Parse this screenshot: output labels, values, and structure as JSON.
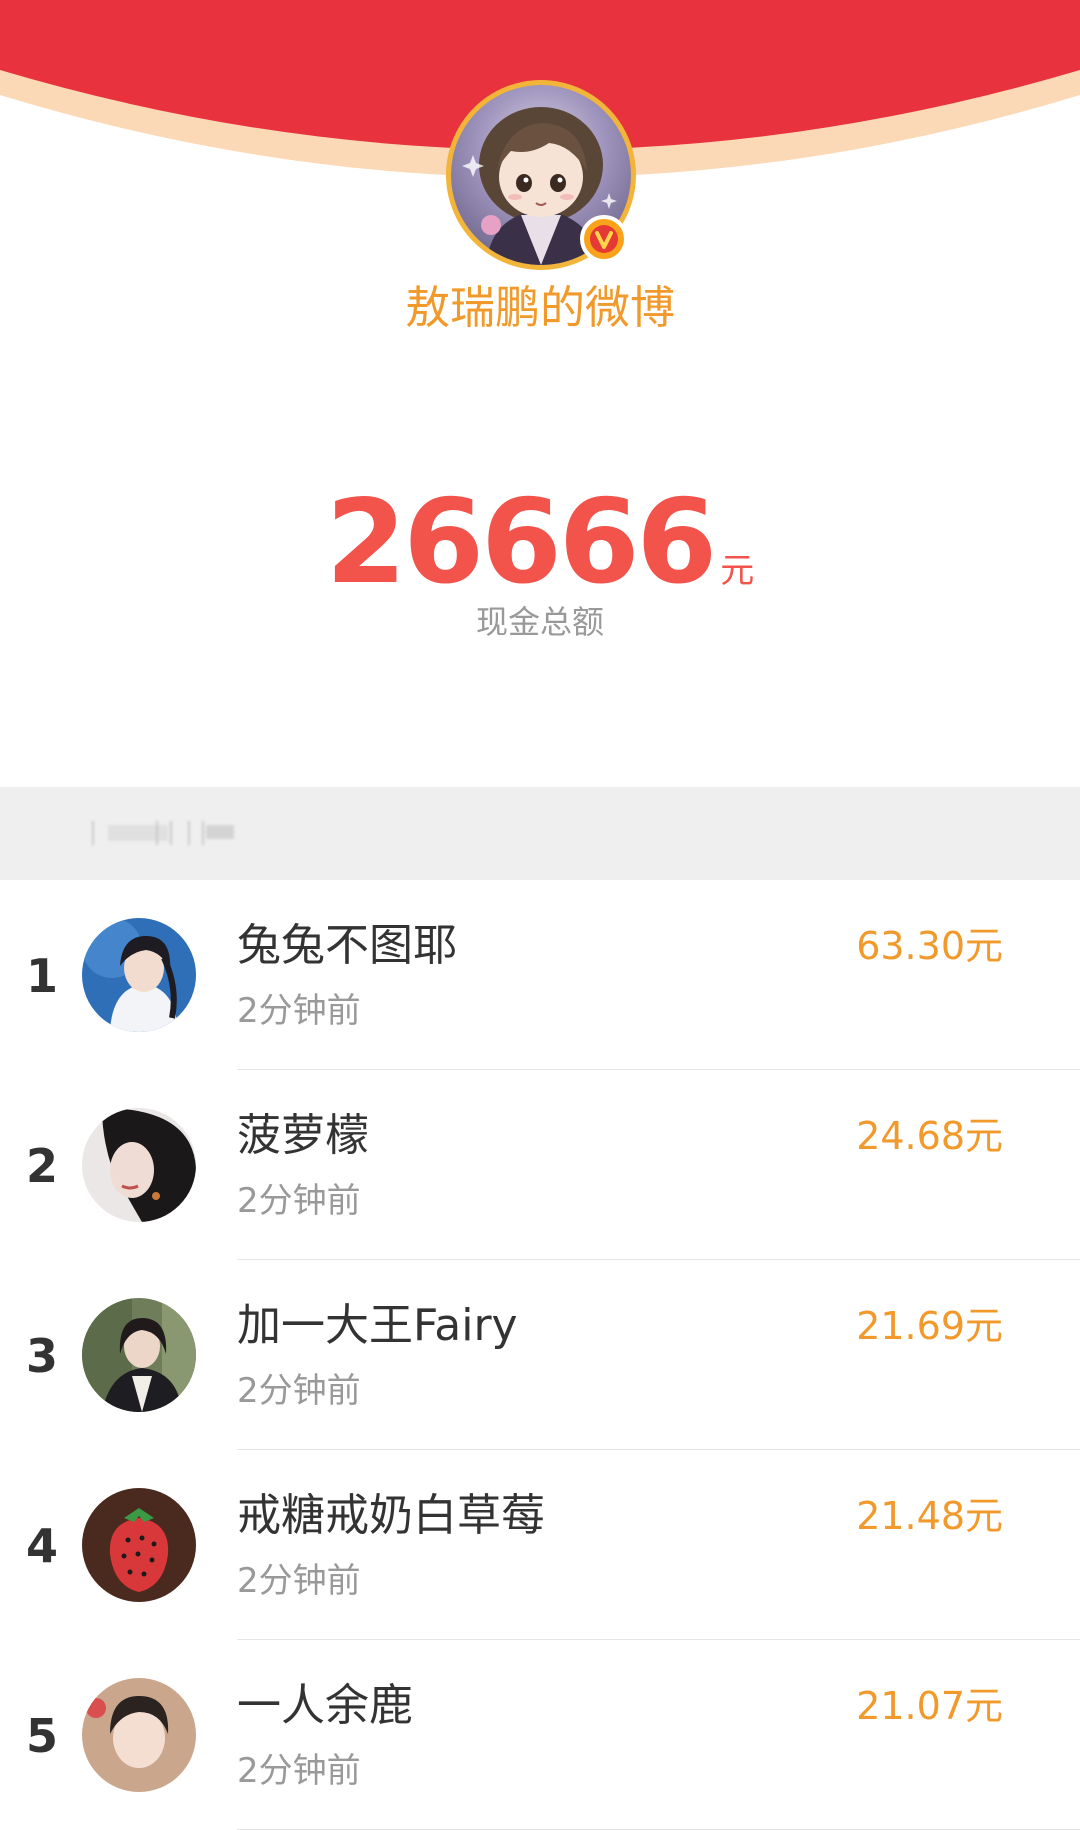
{
  "header": {
    "owner_name": "敖瑞鹏的微博",
    "avatar_icon": "anime-portrait-avatar",
    "verified_icon": "verified-v-badge-icon",
    "colors": {
      "banner_red": "#e8323d",
      "banner_rim": "#fbd9b6",
      "gold": "#f19a2b",
      "amount_red": "#f2534b"
    }
  },
  "summary": {
    "total_amount": "26666",
    "total_unit": "元",
    "total_label": "现金总额"
  },
  "donors": [
    {
      "rank": "1",
      "name": "兔兔不图耶",
      "time": "2分钟前",
      "amount": "63.30元"
    },
    {
      "rank": "2",
      "name": "菠萝檬",
      "time": "2分钟前",
      "amount": "24.68元"
    },
    {
      "rank": "3",
      "name": "加一大王Fairy",
      "time": "2分钟前",
      "amount": "21.69元"
    },
    {
      "rank": "4",
      "name": "戒糖戒奶白草莓",
      "time": "2分钟前",
      "amount": "21.48元"
    },
    {
      "rank": "5",
      "name": "一人余鹿",
      "time": "2分钟前",
      "amount": "21.07元"
    }
  ]
}
